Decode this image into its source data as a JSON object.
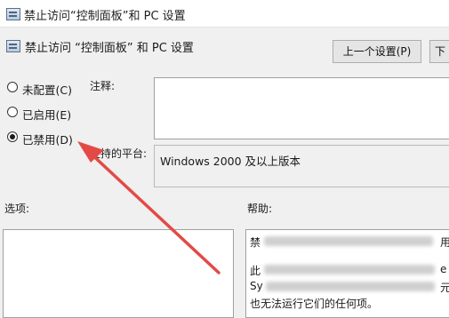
{
  "window": {
    "title": "禁止访问“控制面板”和 PC 设置"
  },
  "header": {
    "title": "禁止访问 “控制面板” 和 PC 设置"
  },
  "toolbar": {
    "prev_label": "上一个设置(P)",
    "next_label": "下"
  },
  "options": [
    {
      "label": "未配置(C)",
      "selected": false
    },
    {
      "label": "已启用(E)",
      "selected": false
    },
    {
      "label": "已禁用(D)",
      "selected": true
    }
  ],
  "comment": {
    "label": "注释:",
    "value": ""
  },
  "platform": {
    "label": "支持的平台:",
    "value": "Windows 2000 及以上版本"
  },
  "options_section": {
    "label": "选项:"
  },
  "help_section": {
    "label": "帮助:",
    "lines": [
      "禁",
      "此",
      "Sy",
      "也无法运行它们的任何项。"
    ],
    "right_fragments": [
      "用",
      "e",
      "元"
    ]
  },
  "annotation": {
    "arrow_color": "#e34a46"
  },
  "colors": {
    "window_bg": "#f0f0f0",
    "button_bg": "#e5e5e5"
  }
}
